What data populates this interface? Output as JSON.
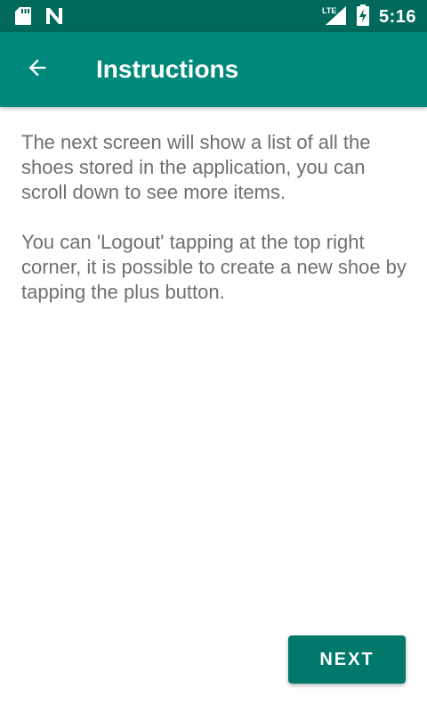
{
  "status_bar": {
    "time": "5:16",
    "network_label": "LTE",
    "icons": [
      "sd-card-icon",
      "n-notification-icon",
      "lte-signal-icon",
      "battery-charging-icon"
    ]
  },
  "app_bar": {
    "title": "Instructions",
    "back_icon": "arrow-left-icon",
    "color": "#00897b"
  },
  "content": {
    "paragraph_1": "The next screen will show a list of all the shoes stored in the application, you can scroll down to see more items.",
    "paragraph_2": "You can 'Logout' tapping at the top right corner, it is possible to create a new shoe by tapping the plus button."
  },
  "actions": {
    "next_label": "NEXT"
  },
  "colors": {
    "status_bar": "#00695c",
    "accent": "#00796b",
    "text": "#6f6f6f"
  }
}
